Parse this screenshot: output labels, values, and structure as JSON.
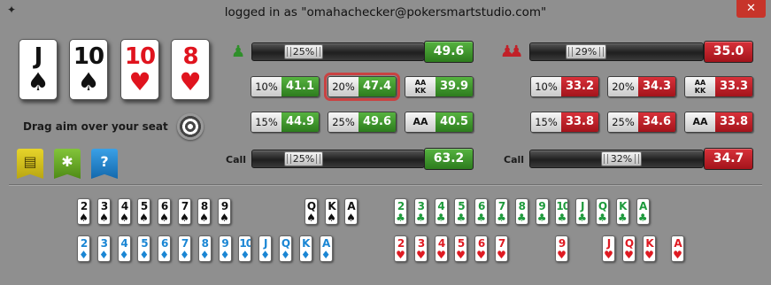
{
  "window": {
    "title": "logged in as \"omahachecker@pokersmartstudio.com\"",
    "close_glyph": "✕",
    "app_icon": "spark-icon"
  },
  "hand": [
    {
      "rank": "J",
      "suit": "♠",
      "color": "black"
    },
    {
      "rank": "10",
      "suit": "♠",
      "color": "black"
    },
    {
      "rank": "10",
      "suit": "♥",
      "color": "red"
    },
    {
      "rank": "8",
      "suit": "♥",
      "color": "red"
    }
  ],
  "drag_text": "Drag aim over your seat",
  "tools": {
    "cards": "cards-icon",
    "settings": "puzzle-icon",
    "help": "?"
  },
  "player1": {
    "icon": "single-player-icon",
    "range_pct": "25%",
    "equity": "49.6",
    "stats": [
      {
        "label": "10%",
        "value": "41.1"
      },
      {
        "label": "20%",
        "value": "47.4"
      },
      {
        "label": "AA\nKK",
        "value": "39.9"
      },
      {
        "label": "15%",
        "value": "44.9"
      },
      {
        "label": "25%",
        "value": "49.6"
      },
      {
        "label": "AA",
        "value": "40.5"
      }
    ],
    "call_label": "Call",
    "call_pct": "25%",
    "call_value": "63.2"
  },
  "player2": {
    "icon": "two-players-icon",
    "range_pct": "29%",
    "equity": "35.0",
    "stats": [
      {
        "label": "10%",
        "value": "33.2"
      },
      {
        "label": "20%",
        "value": "34.3"
      },
      {
        "label": "AA\nKK",
        "value": "33.3"
      },
      {
        "label": "15%",
        "value": "33.8"
      },
      {
        "label": "25%",
        "value": "34.6"
      },
      {
        "label": "AA",
        "value": "33.8"
      }
    ],
    "call_label": "Call",
    "call_pct": "32%",
    "call_value": "34.7"
  },
  "colors": {
    "green": "#3c9a2b",
    "red": "#c0202a",
    "background": "#8f8f8f"
  },
  "deck": {
    "spades": [
      "2",
      "3",
      "4",
      "5",
      "6",
      "7",
      "8",
      "9",
      "Q",
      "K",
      "A"
    ],
    "clubs": [
      "2",
      "3",
      "4",
      "5",
      "6",
      "7",
      "8",
      "9",
      "10",
      "J",
      "Q",
      "K",
      "A"
    ],
    "diamonds": [
      "2",
      "3",
      "4",
      "5",
      "6",
      "7",
      "8",
      "9",
      "10",
      "J",
      "Q",
      "K",
      "A"
    ],
    "hearts": [
      "2",
      "3",
      "4",
      "5",
      "6",
      "7",
      "9",
      "J",
      "Q",
      "K",
      "A"
    ],
    "suit_glyphs": {
      "spades": "♠",
      "clubs": "♣",
      "diamonds": "♦",
      "hearts": "♥"
    }
  }
}
